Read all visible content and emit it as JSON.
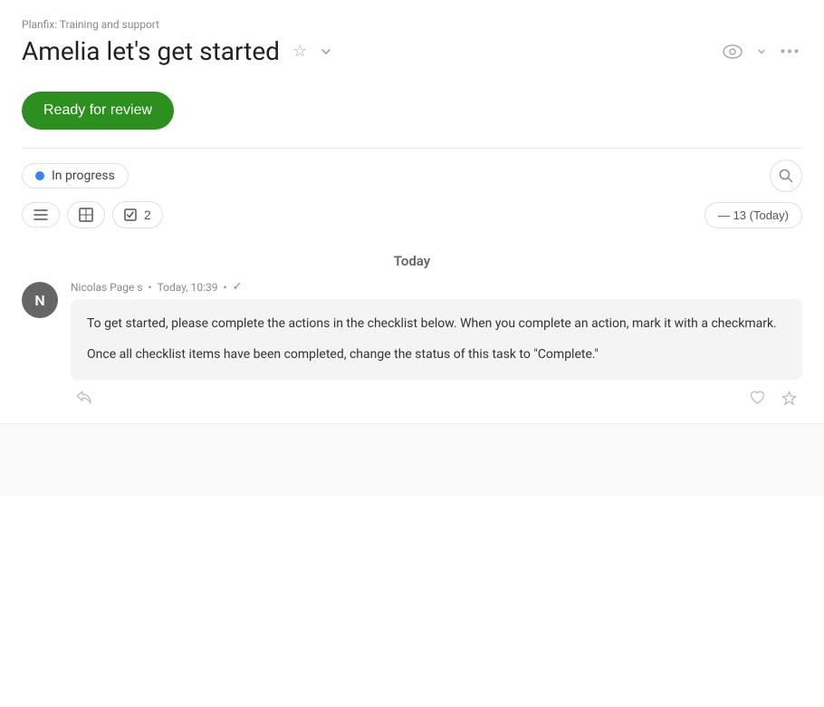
{
  "breadcrumb": "Planfix: Training and support",
  "title": "Amelia let's get started",
  "status_button": "Ready for review",
  "in_progress_label": "In progress",
  "toolbar": {
    "date_range": "— 13 (Today)"
  },
  "today_label": "Today",
  "comment": {
    "author": "Nicolas Page s",
    "timestamp": "Today, 10:39",
    "avatar_letter": "N",
    "avatar_bg": "#666",
    "paragraph1": "To get started, please complete the actions in the checklist below. When you complete an action, mark it with a checkmark.",
    "paragraph2": "Once all checklist items have been completed, change the status of this task to \"Complete.\""
  },
  "icons": {
    "star": "☆",
    "chevron": "▾",
    "eye": "👁",
    "more": "•••",
    "search": "○",
    "lines": "≡",
    "align": "⊞",
    "checklist_count": "2"
  }
}
